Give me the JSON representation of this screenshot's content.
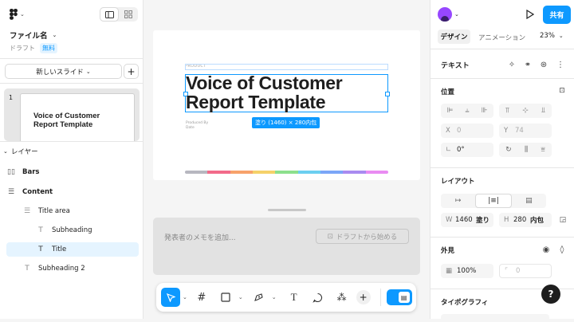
{
  "app": {
    "file_name": "ファイル名",
    "draft_label": "ドラフト",
    "plan_badge": "無料"
  },
  "left_panel": {
    "new_slide_label": "新しいスライド",
    "slide_number": "1",
    "slide_thumb_title": "Voice of Customer Report Template",
    "layers_header": "レイヤー",
    "layers": [
      {
        "name": "Bars",
        "icon": "bars-frame-icon"
      },
      {
        "name": "Content",
        "icon": "autolayout-icon"
      },
      {
        "name": "Title area",
        "icon": "autolayout-icon"
      },
      {
        "name": "Subheading",
        "icon": "text-icon"
      },
      {
        "name": "Title",
        "icon": "text-icon",
        "selected": true
      },
      {
        "name": "Subheading 2",
        "icon": "text-icon"
      }
    ]
  },
  "canvas": {
    "product_label": "PRODUCT",
    "title_line1": "Voice of Customer",
    "title_line2": "Report Template",
    "produced_by": "Produced By",
    "date": "Date",
    "size_badge": "塗り (1460) × 280内包",
    "bar_colors": [
      "#b7b7c0",
      "#f26b8a",
      "#f7a26b",
      "#f5d16a",
      "#8de08d",
      "#6ccff0",
      "#7ba6f7",
      "#a98bf0",
      "#e98cf2"
    ],
    "notes_placeholder": "発表者のメモを追加...",
    "notes_button": "ドラフトから始める"
  },
  "right_panel": {
    "share_label": "共有",
    "tabs": {
      "design": "デザイン",
      "animation": "アニメーション"
    },
    "zoom": "23%",
    "text_header": "テキスト",
    "position_header": "位置",
    "x_label": "X",
    "x_value": "0",
    "y_label": "Y",
    "y_value": "74",
    "rotation_value": "0°",
    "layout_header": "レイアウト",
    "w_label": "W",
    "w_value": "1460",
    "w_mode": "塗り",
    "h_label": "H",
    "h_value": "280",
    "h_mode": "内包",
    "appearance_header": "外見",
    "opacity_value": "100%",
    "radius_value": "0",
    "typography_header": "タイポグラフィ",
    "help_label": "?",
    "accent": "#0d99ff"
  }
}
